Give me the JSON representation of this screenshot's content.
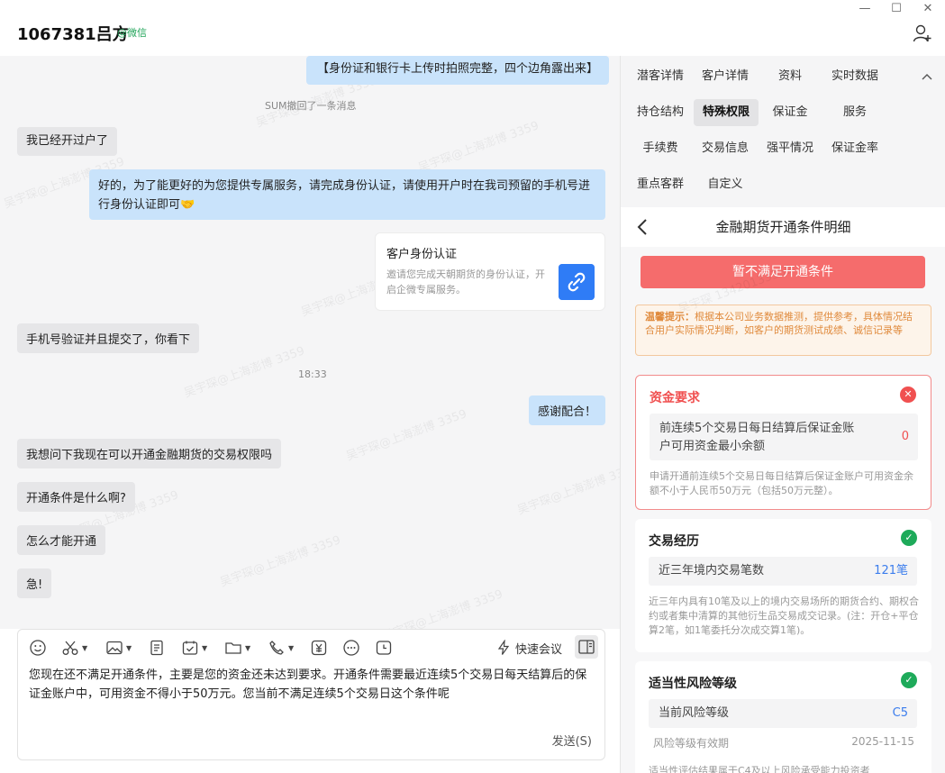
{
  "header": {
    "name": "1067381吕方",
    "source_tag": "@微信"
  },
  "window_controls": {
    "minimize": "—",
    "maximize": "☐",
    "close": "✕"
  },
  "messages": [
    {
      "dir": "out",
      "text": "【身份证和银行卡上传时拍照完整，四个边角露出来】"
    },
    {
      "dir": "sys",
      "text": "SUM撤回了一条消息"
    },
    {
      "dir": "in",
      "text": "我已经开过户了"
    },
    {
      "dir": "out",
      "text": "好的，为了能更好的为您提供专属服务，请完成身份认证，请使用开户时在我司预留的手机号进行身份认证即可🤝"
    },
    {
      "dir": "card",
      "title": "客户身份认证",
      "desc": "邀请您完成天朝期货的身份认证，开启企微专属服务。"
    },
    {
      "dir": "in",
      "text": "手机号验证并且提交了，你看下"
    },
    {
      "dir": "sys",
      "text": "18:33"
    },
    {
      "dir": "out",
      "text": "感谢配合！"
    },
    {
      "dir": "in",
      "text": "我想问下我现在可以开通金融期货的交易权限吗"
    },
    {
      "dir": "in",
      "text": "开通条件是什么啊?"
    },
    {
      "dir": "in",
      "text": "怎么才能开通"
    },
    {
      "dir": "in",
      "text": "急!"
    }
  ],
  "watermark": "吴宇琛@上海澎博 3359",
  "watermark_phone": "吴宇琛 13420133359",
  "composer": {
    "quick_meeting": "快速会议",
    "draft": "您现在还不满足开通条件，主要是您的资金还未达到要求。开通条件需要最近连续5个交易日每天结算后的保证金账户中，可用资金不得小于50万元。您当前不满足连续5个交易日这个条件呢",
    "send": "发送(S)"
  },
  "tabs": [
    {
      "label": "潜客详情"
    },
    {
      "label": "客户详情"
    },
    {
      "label": "资料"
    },
    {
      "label": "实时数据"
    },
    {
      "label": "持仓结构"
    },
    {
      "label": "特殊权限",
      "active": true
    },
    {
      "label": "保证金"
    },
    {
      "label": "服务"
    },
    {
      "label": "手续费"
    },
    {
      "label": "交易信息"
    },
    {
      "label": "强平情况"
    },
    {
      "label": "保证金率"
    },
    {
      "label": "重点客群"
    },
    {
      "label": "自定义"
    }
  ],
  "detail": {
    "title": "金融期货开通条件明细",
    "status_button": "暂不满足开通条件",
    "tip_label": "温馨提示：",
    "tip_text": "根据本公司业务数据推测，提供参考，具体情况结合用户实际情况判断，如客户的期货测试成绩、诚信记录等",
    "sections": [
      {
        "title": "资金要求",
        "met": false,
        "row_label": "前连续5个交易日每日结算后保证金账户可用资金最小余额",
        "row_value": "0",
        "note": "申请开通前连续5个交易日每日结算后保证金账户可用资金余额不小于人民币50万元（包括50万元整）。"
      },
      {
        "title": "交易经历",
        "met": true,
        "row_label": "近三年境内交易笔数",
        "row_value": "121笔",
        "note": "近三年内具有10笔及以上的境内交易场所的期货合约、期权合约或者集中清算的其他衍生品交易成交记录。(注：开仓+平仓算2笔，如1笔委托分次成交算1笔)。"
      },
      {
        "title": "适当性风险等级",
        "met": true,
        "row_label": "当前风险等级",
        "row_value": "C5",
        "sub_label": "风险等级有效期",
        "sub_value": "2025-11-15",
        "note": "适当性评估结果属于C4及以上风险承受能力投资者"
      }
    ]
  }
}
